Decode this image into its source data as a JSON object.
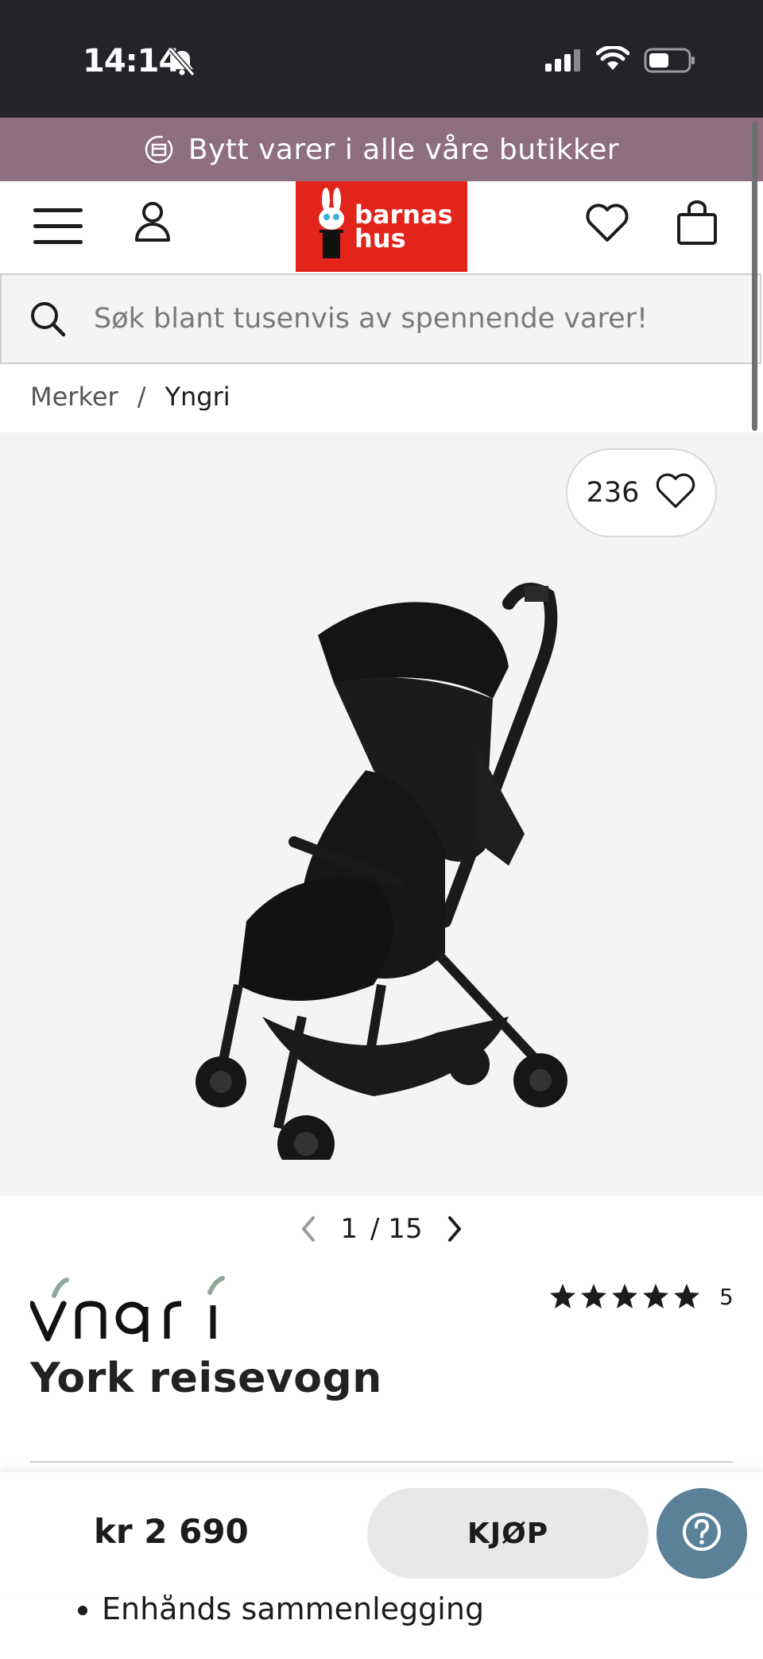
{
  "status_bar": {
    "time": "14:14"
  },
  "promo": {
    "text": "Bytt varer i alle våre butikker"
  },
  "header": {
    "logo_line1": "barnas",
    "logo_line2": "hus"
  },
  "search": {
    "placeholder": "Søk blant tusenvis av spennende varer!"
  },
  "breadcrumb": {
    "items": [
      "Merker",
      "Yngri"
    ],
    "separator": "/"
  },
  "gallery": {
    "wishlist_count": "236",
    "current": "1",
    "total": "/ 15"
  },
  "product": {
    "brand": "Yngri",
    "title": "York reisevogn",
    "rating_stars": 5,
    "rating_count": "5",
    "bullets": [
      "Enhånds sammenlegging"
    ]
  },
  "buy_bar": {
    "price": "kr 2 690",
    "buy_label": "KJØP"
  },
  "colors": {
    "promo_bg": "#8d6f80",
    "logo_red": "#e3241b",
    "help_blue": "#5b8199",
    "status_bg": "#23242a"
  }
}
